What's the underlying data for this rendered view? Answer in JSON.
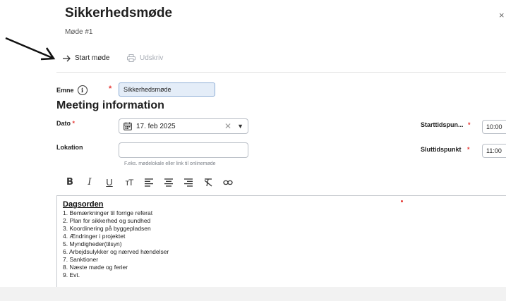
{
  "header": {
    "title": "Sikkerhedsmøde",
    "subtitle": "Møde #1",
    "close_glyph": "×"
  },
  "toolbar": {
    "start_label": "Start møde",
    "print_label": "Udskriv"
  },
  "form": {
    "emne_label": "Emne",
    "emne_value": "Sikkerhedsmøde",
    "section_title": "Meeting information",
    "dato_label": "Dato",
    "dato_value": "17. feb 2025",
    "lokation_label": "Lokation",
    "lokation_value": "",
    "lokation_hint": "F.eks. mødelokale eller link til onlinemøde",
    "starttid_label": "Starttidspun...",
    "starttid_value": "10:00",
    "sluttid_label": "Sluttidspunkt",
    "sluttid_value": "11:00",
    "required_mark": "*"
  },
  "editor": {
    "tools": [
      "B",
      "I",
      "U",
      "tT",
      "align-left",
      "align-center",
      "align-right",
      "clear-format",
      "link"
    ],
    "agenda_title": "Dagsorden",
    "agenda_items": [
      "1. Bemærkninger til forrige referat",
      "2. Plan for sikkerhed og sundhed",
      "3. Koordinering på byggepladsen",
      "4. Ændringer i projektet",
      "5. Myndigheder(tilsyn)",
      "6. Arbejdsulykker og nærved hændelser",
      "7. Sanktioner",
      "8. Næste møde og ferier",
      "9. Evt."
    ]
  },
  "colors": {
    "accent": "#8eaed6",
    "required": "#e53935",
    "disabled": "#a8adb5"
  }
}
